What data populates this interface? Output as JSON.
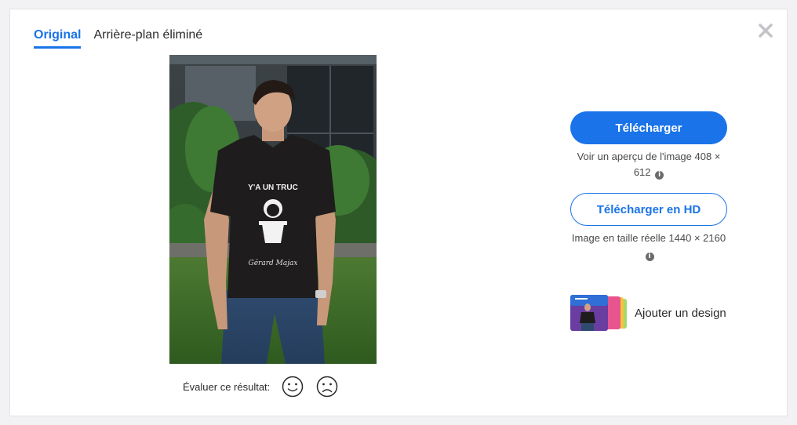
{
  "tabs": [
    {
      "label": "Original",
      "active": true
    },
    {
      "label": "Arrière-plan éliminé",
      "active": false
    }
  ],
  "close_icon": "close-icon",
  "photo": {
    "shirt_text": "Y'A UN TRUC",
    "signature": "Gérard Majax"
  },
  "rating": {
    "label": "Évaluer ce résultat:",
    "positive_icon": "smile-icon",
    "negative_icon": "frown-icon"
  },
  "actions": {
    "download_label": "Télécharger",
    "preview_caption": "Voir un aperçu de l'image 408 × 612",
    "download_hd_label": "Télécharger en HD",
    "hd_caption": "Image en taille réelle 1440 × 2160",
    "add_design_label": "Ajouter un design"
  },
  "colors": {
    "accent": "#1a73e8",
    "text": "#2b2b2b"
  }
}
